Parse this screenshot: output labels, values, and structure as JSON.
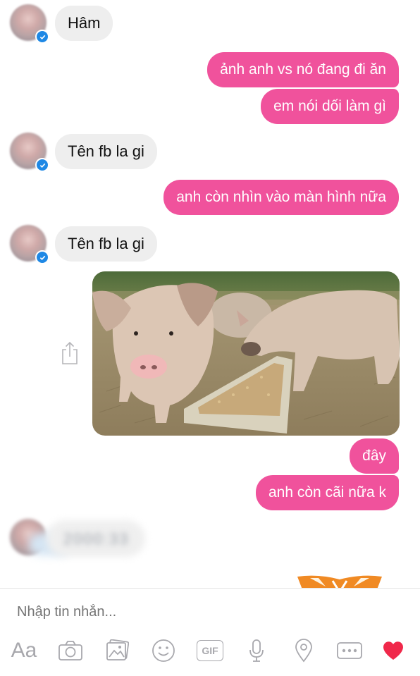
{
  "messages": [
    {
      "side": "in",
      "text": "Hâm"
    },
    {
      "side": "out",
      "text": "ảnh anh vs nó đang đi ăn"
    },
    {
      "side": "out",
      "text": "em nói dối làm gì"
    },
    {
      "side": "in",
      "text": "Tên fb la gi"
    },
    {
      "side": "out",
      "text": "anh còn nhìn vào màn hình nữa"
    },
    {
      "side": "in",
      "text": "Tên fb la gi"
    },
    {
      "side": "out",
      "text": "đây"
    },
    {
      "side": "out",
      "text": "anh còn cãi nữa k"
    },
    {
      "side": "in",
      "text": "2000:33"
    }
  ],
  "composer": {
    "placeholder": "Nhập tin nhắn...",
    "aa_label": "Aa",
    "gif_label": "GIF"
  },
  "colors": {
    "outgoing_bubble": "#f0529c",
    "incoming_bubble": "#eeeeee",
    "verified_badge": "#1e88e5",
    "heart": "#f0284a",
    "icon": "#a8a8ad"
  },
  "icons": [
    "share-icon",
    "camera-icon",
    "image-icon",
    "smiley-icon",
    "gif-icon",
    "microphone-icon",
    "location-icon",
    "more-icon",
    "heart-icon",
    "verified-badge-icon"
  ],
  "image_alt": "Pigs eating from a feeding trough"
}
